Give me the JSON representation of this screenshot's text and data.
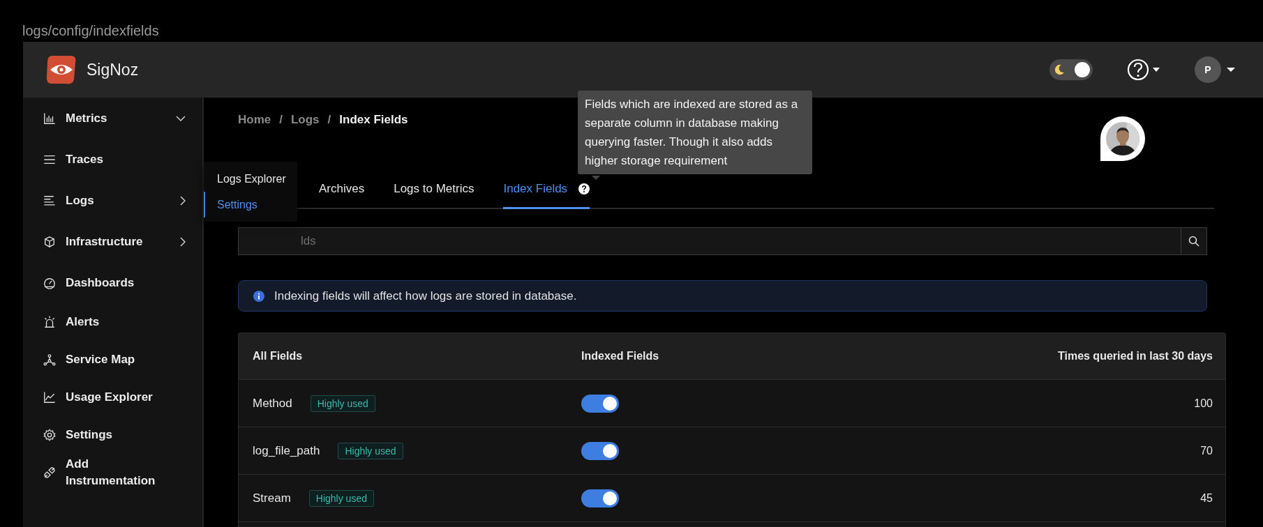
{
  "path": "logs/config/indexfields",
  "header": {
    "brand": "SigNoz",
    "theme_toggle": {
      "on": true
    },
    "user_initial": "P"
  },
  "sidebar": {
    "items": [
      {
        "label": "Metrics",
        "kind": "accordion"
      },
      {
        "label": "Traces",
        "kind": "link"
      },
      {
        "label": "Logs",
        "kind": "flyout",
        "children": [
          {
            "label": "Logs Explorer",
            "selected": false
          },
          {
            "label": "Settings",
            "selected": true
          }
        ]
      },
      {
        "label": "Infrastructure",
        "kind": "flyout"
      },
      {
        "label": "Dashboards",
        "kind": "link"
      },
      {
        "label": "Alerts",
        "kind": "link"
      },
      {
        "label": "Service Map",
        "kind": "link"
      },
      {
        "label": "Usage Explorer",
        "kind": "link"
      },
      {
        "label": "Settings",
        "kind": "link"
      },
      {
        "label": "Add Instrumentation",
        "kind": "link"
      }
    ]
  },
  "breadcrumb": [
    {
      "text": "Home",
      "kind": "link"
    },
    {
      "text": "/",
      "kind": "separator"
    },
    {
      "text": "Logs",
      "kind": "link"
    },
    {
      "text": "/",
      "kind": "separator"
    },
    {
      "text": "Index Fields",
      "kind": "current"
    }
  ],
  "tabs": [
    {
      "label": "Archives",
      "selected": false
    },
    {
      "label": "Logs to Metrics",
      "selected": false
    },
    {
      "label": "Index Fields",
      "selected": true,
      "help": true
    }
  ],
  "tooltip": "Fields which are indexed are stored as a separate column in database making querying faster. Though it also adds higher storage requirement",
  "search": {
    "placeholder": "lds"
  },
  "alert": "Indexing fields will affect how logs are stored in database.",
  "table": {
    "columns": [
      "All Fields",
      "Indexed Fields",
      "Times queried in last 30 days"
    ],
    "rows": [
      {
        "field": "Method",
        "badge": "Highly used",
        "indexed": true,
        "count": "100"
      },
      {
        "field": "log_file_path",
        "badge": "Highly used",
        "indexed": true,
        "count": "70"
      },
      {
        "field": "Stream",
        "badge": "Highly used",
        "indexed": true,
        "count": "45"
      }
    ]
  }
}
